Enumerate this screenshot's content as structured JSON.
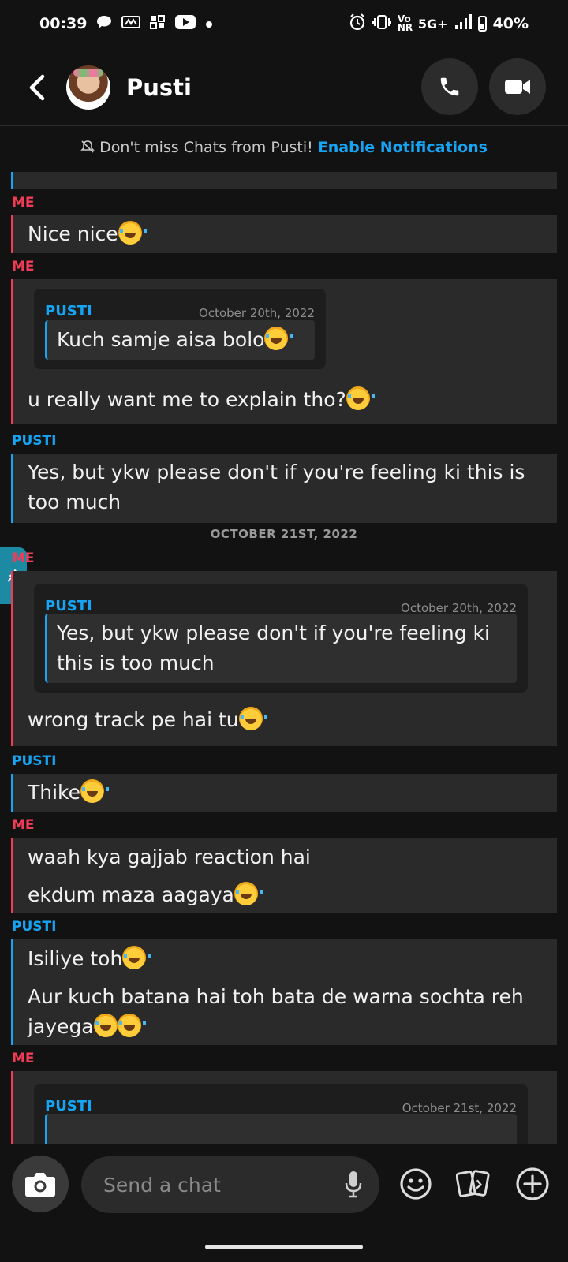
{
  "status_bar": {
    "time": "00:39",
    "network": "5G+",
    "carrier": "Vo NR",
    "battery": "40%"
  },
  "header": {
    "contact_name": "Pusti"
  },
  "notification": {
    "text": "Don't miss Chats from Pusti!",
    "link": "Enable Notifications"
  },
  "messages": {
    "m1": {
      "sender": "ME",
      "text": "Nice nice"
    },
    "m2": {
      "sender": "ME",
      "quote_sender": "PUSTI",
      "quote_date": "October 20th, 2022",
      "quote_text": "Kuch samje aisa bolo",
      "text": "u really want me to explain tho?"
    },
    "m3": {
      "sender": "PUSTI",
      "text": "Yes, but ykw please don't if you're feeling ki this is too much"
    },
    "date_separator": "OCTOBER 21ST, 2022",
    "m4": {
      "sender": "ME",
      "quote_sender": "PUSTI",
      "quote_date": "October 20th, 2022",
      "quote_text": "Yes, but ykw please don't if you're feeling ki this is too much",
      "text": "wrong track pe hai tu"
    },
    "m5": {
      "sender": "PUSTI",
      "text": "Thike"
    },
    "m6": {
      "sender": "ME",
      "line1": "waah kya gajjab reaction hai",
      "line2": "ekdum maza aagaya"
    },
    "m7": {
      "sender": "PUSTI",
      "line1": "Isiliye toh",
      "line2": "Aur kuch batana hai toh bata de warna sochta reh jayega"
    },
    "m8": {
      "sender": "ME",
      "quote_sender": "PUSTI",
      "quote_date": "October 21st, 2022"
    }
  },
  "composer": {
    "placeholder": "Send a chat"
  },
  "colors": {
    "me": "#f23c57",
    "pusti": "#16a5f5",
    "background": "#121212",
    "bubble": "#2a2a2a"
  }
}
